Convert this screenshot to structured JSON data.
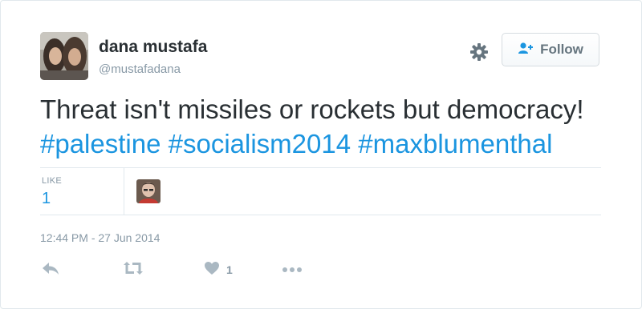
{
  "author": {
    "name": "dana mustafa",
    "handle": "@mustafadana"
  },
  "header": {
    "follow_label": "Follow"
  },
  "tweet": {
    "text": "Threat isn't missiles or rockets but democracy!",
    "hashtags": [
      "#palestine",
      "#socialism2014",
      "#maxblumenthal"
    ]
  },
  "stats": {
    "likes_label": "LIKE",
    "likes_value": "1"
  },
  "timestamp": "12:44 PM - 27 Jun 2014",
  "actions": {
    "reply_icon": "reply-icon",
    "retweet_icon": "retweet-icon",
    "like_icon": "heart-icon",
    "like_count": "1",
    "more_icon": "more-icon"
  },
  "colors": {
    "link": "#1b95e0",
    "muted": "#8899a6",
    "text": "#292f33",
    "border": "#e1e8ed"
  }
}
